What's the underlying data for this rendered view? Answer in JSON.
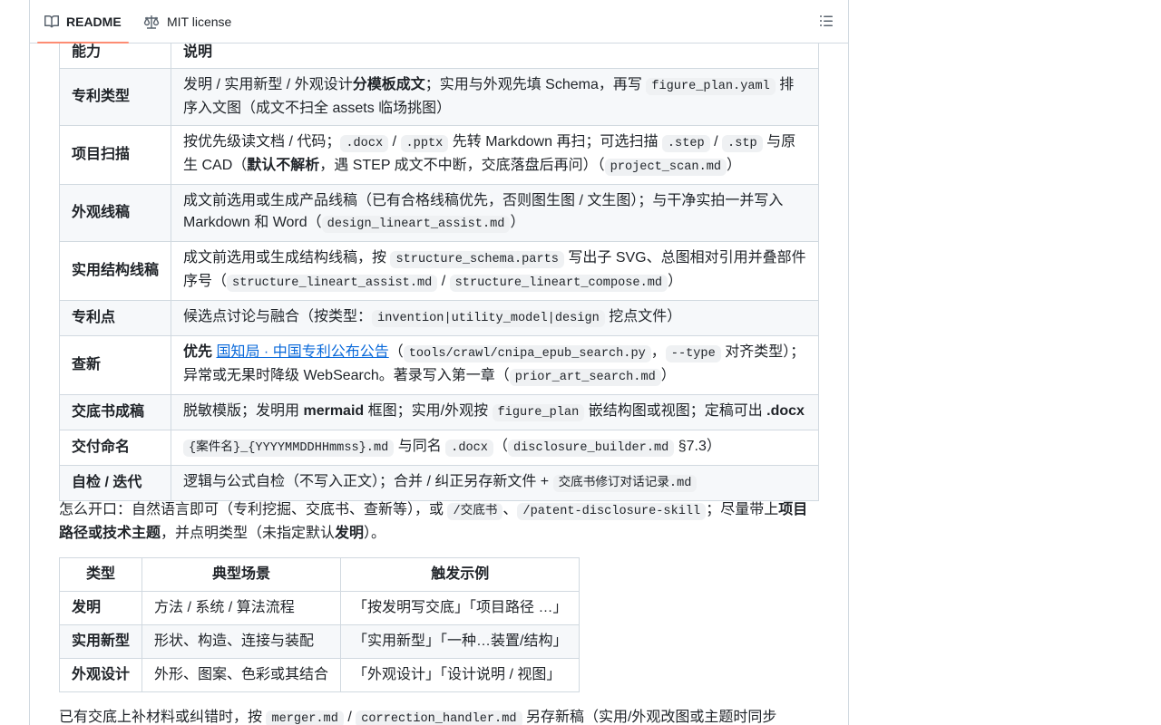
{
  "tabs": {
    "readme": "README",
    "license": "MIT license"
  },
  "icons": {
    "readme": "book-icon",
    "license": "law-icon",
    "toc": "list-unordered-icon"
  },
  "colors": {
    "link": "#0969da",
    "tab_underline": "#fd8c73",
    "border": "#d1d9e0"
  },
  "table1": {
    "head_ability": "能力",
    "head_desc": "说明",
    "rows": {
      "r1": {
        "key": "专利类型",
        "t1": "发明 / 实用新型 / 外观设计",
        "b1": "分模板成文",
        "t2": "；实用与外观先填 Schema，再写 ",
        "c1": "figure_plan.yaml",
        "t3": " 排序入文图（成文不扫全 assets 临场挑图）"
      },
      "r2": {
        "key": "项目扫描",
        "t1": "按优先级读文档 / 代码；",
        "c1": ".docx",
        "t2": " / ",
        "c2": ".pptx",
        "t3": " 先转 Markdown 再扫；可选扫描 ",
        "c3": ".step",
        "t4": " / ",
        "c4": ".stp",
        "t5": " 与原生 CAD（",
        "b1": "默认不解析",
        "t6": "，遇 STEP 成文不中断，交底落盘后再问）（",
        "c5": "project_scan.md",
        "t7": "）"
      },
      "r3": {
        "key": "外观线稿",
        "t1": "成文前选用或生成产品线稿（已有合格线稿优先，否则图生图 / 文生图）；与干净实拍一并写入 Markdown 和 Word（",
        "c1": "design_lineart_assist.md",
        "t2": "）"
      },
      "r4": {
        "key": "实用结构线稿",
        "t1": "成文前选用或生成结构线稿，按 ",
        "c1": "structure_schema.parts",
        "t2": " 写出子 SVG、总图相对引用并叠部件序号（",
        "c2": "structure_lineart_assist.md",
        "t3": " / ",
        "c3": "structure_lineart_compose.md",
        "t4": "）"
      },
      "r5": {
        "key": "专利点",
        "t1": "候选点讨论与融合（按类型：",
        "c1": "invention|utility_model|design",
        "t2": " 挖点文件）"
      },
      "r6": {
        "key": "查新",
        "b1": "优先",
        "link": "国知局 · 中国专利公布公告",
        "t1": "（",
        "c1": "tools/crawl/cnipa_epub_search.py",
        "t2": "，",
        "c2": "--type",
        "t3": " 对齐类型）；异常或无果时降级 WebSearch。著录写入第一章（",
        "c3": "prior_art_search.md",
        "t4": "）"
      },
      "r7": {
        "key": "交底书成稿",
        "t1": "脱敏模版；发明用 ",
        "b1": "mermaid",
        "t2": " 框图；实用/外观按 ",
        "c1": "figure_plan",
        "t3": " 嵌结构图或视图；定稿可出 ",
        "b2": ".docx"
      },
      "r8": {
        "key": "交付命名",
        "c1": "{案件名}_{YYYYMMDDHHmmss}.md",
        "t1": " 与同名 ",
        "c2": ".docx",
        "t2": "（",
        "c3": "disclosure_builder.md",
        "t3": " §7.3）"
      },
      "r9": {
        "key": "自检 / 迭代",
        "t1": "逻辑与公式自检（不写入正文）；合并 / 纠正另存新文件 + ",
        "c1": "交底书修订对话记录.md"
      }
    }
  },
  "para1": {
    "t1": "怎么开口：自然语言即可（专利挖掘、交底书、查新等），或 ",
    "c1": "/交底书",
    "t2": "、",
    "c2": "/patent-disclosure-skill",
    "t3": "；尽量带上",
    "b1": "项目路径或技术主题",
    "t4": "，并点明类型（未指定默认",
    "b2": "发明",
    "t5": "）。"
  },
  "table2": {
    "headers": [
      "类型",
      "典型场景",
      "触发示例"
    ],
    "rows": [
      [
        "发明",
        "方法 / 系统 / 算法流程",
        "「按发明写交底」「项目路径 …」"
      ],
      [
        "实用新型",
        "形状、构造、连接与装配",
        "「实用新型」「一种…装置/结构」"
      ],
      [
        "外观设计",
        "外形、图案、色彩或其结合",
        "「外观设计」「设计说明 / 视图」"
      ]
    ]
  },
  "para2": {
    "t1": "已有交底上补材料或纠错时，按 ",
    "c1": "merger.md",
    "t2": " / ",
    "c2": "correction_handler.md",
    "t3": " 另存新稿（实用/外观改图或主题时同步"
  }
}
